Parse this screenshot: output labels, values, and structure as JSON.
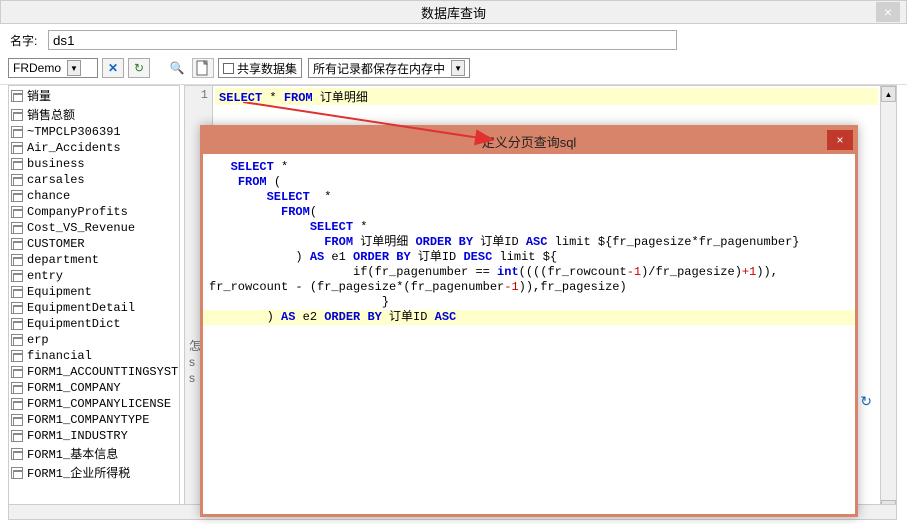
{
  "window": {
    "title": "数据库查询",
    "close_glyph": "×"
  },
  "name_row": {
    "label": "名字:",
    "value": "ds1"
  },
  "toolbar": {
    "db_combo": "FRDemo",
    "settings_glyph": "✂",
    "refresh_glyph": "↻",
    "preview_glyph": "🔍",
    "page_glyph": "📄",
    "share_label": "共享数据集",
    "storage_combo": "所有记录都保存在内存中"
  },
  "editor": {
    "gutter_1": "1",
    "line1_kw1": "SELECT",
    "line1_star": " * ",
    "line1_kw2": "FROM",
    "line1_tbl": " 订单明细"
  },
  "side_text": [
    "怎",
    "s",
    "s"
  ],
  "tree": {
    "items": [
      "销量",
      "销售总额",
      "~TMPCLP306391",
      "Air_Accidents",
      "business",
      "carsales",
      "chance",
      "CompanyProfits",
      "Cost_VS_Revenue",
      "CUSTOMER",
      "department",
      "entry",
      "Equipment",
      "EquipmentDetail",
      "EquipmentDict",
      "erp",
      "financial",
      "FORM1_ACCOUNTTINGSYST",
      "FORM1_COMPANY",
      "FORM1_COMPANYLICENSE",
      "FORM1_COMPANYTYPE",
      "FORM1_INDUSTRY",
      "FORM1_基本信息",
      "FORM1_企业所得税"
    ]
  },
  "popup": {
    "title": "定义分页查询sql",
    "close_glyph": "×",
    "sql": [
      {
        "indent": 3,
        "parts": [
          {
            "t": "SELECT",
            "c": "kw"
          },
          {
            "t": " *"
          }
        ]
      },
      {
        "indent": 4,
        "parts": [
          {
            "t": "FROM",
            "c": "kw"
          },
          {
            "t": " ("
          }
        ]
      },
      {
        "indent": 8,
        "parts": [
          {
            "t": "SELECT",
            "c": "kw"
          },
          {
            "t": "  *"
          }
        ]
      },
      {
        "indent": 10,
        "parts": [
          {
            "t": "FROM",
            "c": "kw"
          },
          {
            "t": "("
          }
        ]
      },
      {
        "indent": 14,
        "parts": [
          {
            "t": "SELECT",
            "c": "kw"
          },
          {
            "t": " *"
          }
        ]
      },
      {
        "indent": 16,
        "parts": [
          {
            "t": "FROM",
            "c": "kw"
          },
          {
            "t": " 订单明细 "
          },
          {
            "t": "ORDER BY",
            "c": "kw"
          },
          {
            "t": " 订单ID "
          },
          {
            "t": "ASC",
            "c": "kw"
          },
          {
            "t": " limit ${fr_pagesize*fr_pagenumber}"
          }
        ]
      },
      {
        "indent": 0,
        "parts": [
          {
            "t": ""
          }
        ]
      },
      {
        "indent": 12,
        "parts": [
          {
            "t": ") "
          },
          {
            "t": "AS",
            "c": "kw"
          },
          {
            "t": " e1 "
          },
          {
            "t": "ORDER BY",
            "c": "kw"
          },
          {
            "t": " 订单ID "
          },
          {
            "t": "DESC",
            "c": "kw"
          },
          {
            "t": " limit ${"
          }
        ]
      },
      {
        "indent": 20,
        "parts": [
          {
            "t": "if(fr_pagenumber == "
          },
          {
            "t": "int",
            "c": "kw"
          },
          {
            "t": "((((fr_rowcount"
          },
          {
            "t": "-1",
            "c": "num"
          },
          {
            "t": ")/fr_pagesize)"
          },
          {
            "t": "+1",
            "c": "num"
          },
          {
            "t": ")),"
          }
        ]
      },
      {
        "indent": 0,
        "parts": [
          {
            "t": "fr_rowcount - (fr_pagesize*(fr_pagenumber"
          },
          {
            "t": "-1",
            "c": "num"
          },
          {
            "t": ")),fr_pagesize)"
          }
        ]
      },
      {
        "indent": 24,
        "parts": [
          {
            "t": "}"
          }
        ]
      },
      {
        "indent": 8,
        "hl": true,
        "parts": [
          {
            "t": ") "
          },
          {
            "t": "AS",
            "c": "kw"
          },
          {
            "t": " e2 "
          },
          {
            "t": "ORDER BY",
            "c": "kw"
          },
          {
            "t": " 订单ID "
          },
          {
            "t": "ASC",
            "c": "kw"
          }
        ]
      }
    ]
  },
  "refresh_icons": {
    "down": "↓",
    "cycle": "↻"
  }
}
